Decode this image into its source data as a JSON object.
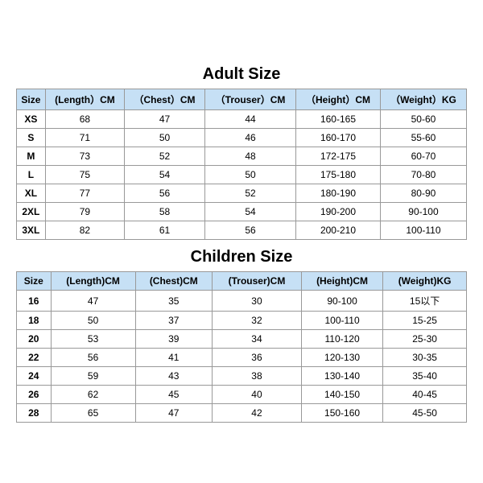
{
  "adult": {
    "title": "Adult Size",
    "headers": [
      "Size",
      "(Length）CM",
      "（Chest）CM",
      "（Trouser）CM",
      "（Height）CM",
      "（Weight）KG"
    ],
    "rows": [
      [
        "XS",
        "68",
        "47",
        "44",
        "160-165",
        "50-60"
      ],
      [
        "S",
        "71",
        "50",
        "46",
        "160-170",
        "55-60"
      ],
      [
        "M",
        "73",
        "52",
        "48",
        "172-175",
        "60-70"
      ],
      [
        "L",
        "75",
        "54",
        "50",
        "175-180",
        "70-80"
      ],
      [
        "XL",
        "77",
        "56",
        "52",
        "180-190",
        "80-90"
      ],
      [
        "2XL",
        "79",
        "58",
        "54",
        "190-200",
        "90-100"
      ],
      [
        "3XL",
        "82",
        "61",
        "56",
        "200-210",
        "100-110"
      ]
    ]
  },
  "children": {
    "title": "Children Size",
    "headers": [
      "Size",
      "(Length)CM",
      "(Chest)CM",
      "(Trouser)CM",
      "(Height)CM",
      "(Weight)KG"
    ],
    "rows": [
      [
        "16",
        "47",
        "35",
        "30",
        "90-100",
        "15以下"
      ],
      [
        "18",
        "50",
        "37",
        "32",
        "100-110",
        "15-25"
      ],
      [
        "20",
        "53",
        "39",
        "34",
        "110-120",
        "25-30"
      ],
      [
        "22",
        "56",
        "41",
        "36",
        "120-130",
        "30-35"
      ],
      [
        "24",
        "59",
        "43",
        "38",
        "130-140",
        "35-40"
      ],
      [
        "26",
        "62",
        "45",
        "40",
        "140-150",
        "40-45"
      ],
      [
        "28",
        "65",
        "47",
        "42",
        "150-160",
        "45-50"
      ]
    ]
  }
}
